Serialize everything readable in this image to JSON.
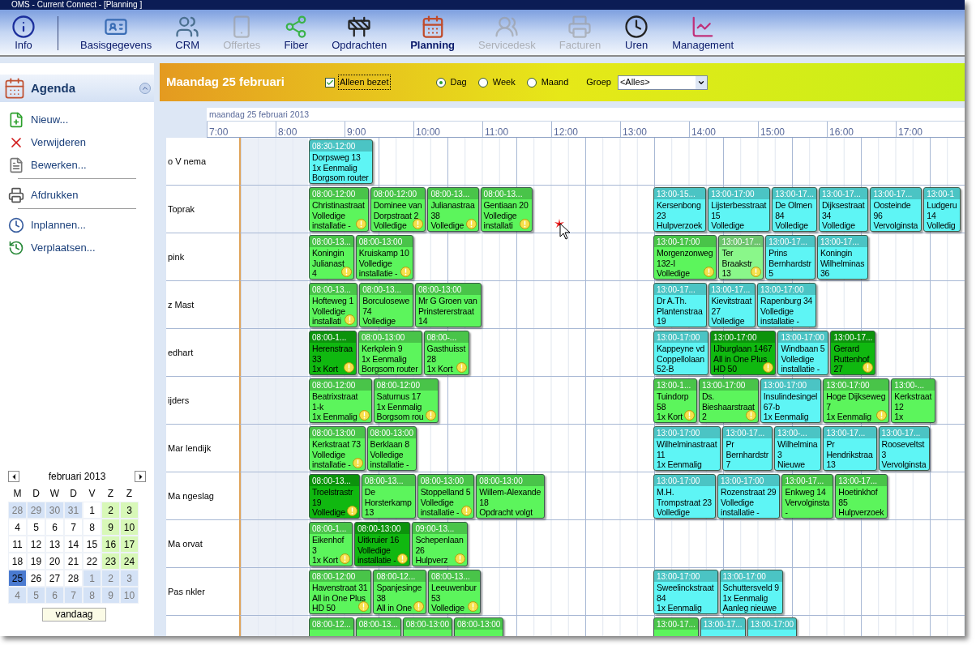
{
  "window": {
    "title": "OMS - Current Connect - [Planning  ]"
  },
  "toolbar": {
    "items": [
      {
        "label": "Info",
        "selected": false,
        "disabled": false
      },
      {
        "label": "Basisgegevens",
        "selected": false,
        "disabled": false
      },
      {
        "label": "CRM",
        "selected": false,
        "disabled": false
      },
      {
        "label": "Offertes",
        "selected": false,
        "disabled": true
      },
      {
        "label": "Fiber",
        "selected": false,
        "disabled": false
      },
      {
        "label": "Opdrachten",
        "selected": false,
        "disabled": false
      },
      {
        "label": "Planning",
        "selected": true,
        "disabled": false
      },
      {
        "label": "Servicedesk",
        "selected": false,
        "disabled": true
      },
      {
        "label": "Facturen",
        "selected": false,
        "disabled": true
      },
      {
        "label": "Uren",
        "selected": false,
        "disabled": false
      },
      {
        "label": "Management",
        "selected": false,
        "disabled": false
      }
    ]
  },
  "sidebar": {
    "title": "Agenda",
    "groups": [
      [
        {
          "label": "Nieuw..."
        },
        {
          "label": "Verwijderen"
        },
        {
          "label": "Bewerken..."
        }
      ],
      [
        {
          "label": "Afdrukken"
        }
      ],
      [
        {
          "label": "Inplannen..."
        },
        {
          "label": "Verplaatsen..."
        }
      ]
    ]
  },
  "mini_calendar": {
    "month": "februari 2013",
    "weekdays": [
      "M",
      "D",
      "W",
      "D",
      "V",
      "Z",
      "Z"
    ],
    "today_button": "vandaag",
    "weeks": [
      [
        {
          "day": "28",
          "kind": "other",
          "selected": false
        },
        {
          "day": "29",
          "kind": "other",
          "selected": false
        },
        {
          "day": "30",
          "kind": "other",
          "selected": false
        },
        {
          "day": "31",
          "kind": "other",
          "selected": false
        },
        {
          "day": "1",
          "kind": "day",
          "selected": false
        },
        {
          "day": "2",
          "kind": "weekend",
          "selected": false
        },
        {
          "day": "3",
          "kind": "weekend",
          "selected": false
        }
      ],
      [
        {
          "day": "4",
          "kind": "day",
          "selected": false
        },
        {
          "day": "5",
          "kind": "day",
          "selected": false
        },
        {
          "day": "6",
          "kind": "day",
          "selected": false
        },
        {
          "day": "7",
          "kind": "day",
          "selected": false
        },
        {
          "day": "8",
          "kind": "day",
          "selected": false
        },
        {
          "day": "9",
          "kind": "weekend",
          "selected": false
        },
        {
          "day": "10",
          "kind": "weekend",
          "selected": false
        }
      ],
      [
        {
          "day": "11",
          "kind": "day",
          "selected": false
        },
        {
          "day": "12",
          "kind": "day",
          "selected": false
        },
        {
          "day": "13",
          "kind": "day",
          "selected": false
        },
        {
          "day": "14",
          "kind": "day",
          "selected": false
        },
        {
          "day": "15",
          "kind": "day",
          "selected": false
        },
        {
          "day": "16",
          "kind": "weekend",
          "selected": false
        },
        {
          "day": "17",
          "kind": "weekend",
          "selected": false
        }
      ],
      [
        {
          "day": "18",
          "kind": "day",
          "selected": false
        },
        {
          "day": "19",
          "kind": "day",
          "selected": false
        },
        {
          "day": "20",
          "kind": "day",
          "selected": false
        },
        {
          "day": "21",
          "kind": "day",
          "selected": false
        },
        {
          "day": "22",
          "kind": "day",
          "selected": false
        },
        {
          "day": "23",
          "kind": "weekend",
          "selected": false
        },
        {
          "day": "24",
          "kind": "weekend",
          "selected": false
        }
      ],
      [
        {
          "day": "25",
          "kind": "day",
          "selected": true
        },
        {
          "day": "26",
          "kind": "day",
          "selected": false
        },
        {
          "day": "27",
          "kind": "day",
          "selected": false
        },
        {
          "day": "28",
          "kind": "day",
          "selected": false
        },
        {
          "day": "1",
          "kind": "other",
          "selected": false
        },
        {
          "day": "2",
          "kind": "other",
          "selected": false
        },
        {
          "day": "3",
          "kind": "other",
          "selected": false
        }
      ],
      [
        {
          "day": "4",
          "kind": "other",
          "selected": false
        },
        {
          "day": "5",
          "kind": "other",
          "selected": false
        },
        {
          "day": "6",
          "kind": "other",
          "selected": false
        },
        {
          "day": "7",
          "kind": "other",
          "selected": false
        },
        {
          "day": "8",
          "kind": "other",
          "selected": false
        },
        {
          "day": "9",
          "kind": "other",
          "selected": false
        },
        {
          "day": "10",
          "kind": "other",
          "selected": false
        }
      ]
    ]
  },
  "header": {
    "title": "Maandag 25 februari",
    "only_busy": {
      "label": "Alleen bezet",
      "checked": true
    },
    "views": [
      {
        "label": "Dag",
        "selected": true
      },
      {
        "label": "Week",
        "selected": false
      },
      {
        "label": "Maand",
        "selected": false
      }
    ],
    "group": {
      "label": "Groep",
      "value": "<Alles>"
    }
  },
  "schedule": {
    "date": "maandag 25 februari 2013",
    "hours": [
      "7:00",
      "8:00",
      "9:00",
      "10:00",
      "11:00",
      "12:00",
      "13:00",
      "14:00",
      "15:00",
      "16:00",
      "17:00"
    ],
    "rows": [
      {
        "name": "o V nema",
        "morning": [
          {
            "time": "08:30-12:00",
            "lines": [
              "Dorpsweg  13",
              "1x Eenmalig",
              "Borgsom router"
            ],
            "color": "#5ef5f5",
            "warning": false
          }
        ],
        "afternoon": []
      },
      {
        "name": "Toprak",
        "morning": [
          {
            "time": "08:00-12:00",
            "lines": [
              "Christinastraat",
              "Volledige",
              "installatie -"
            ],
            "color": "#5cf55c",
            "warning": true
          },
          {
            "time": "08:00-12:00",
            "lines": [
              "Dominee van",
              "Dorpstraat 2",
              "Volledige"
            ],
            "color": "#5cf55c",
            "warning": true
          },
          {
            "time": "08:00-13...",
            "lines": [
              "Julianastraa",
              "38",
              "Volledige"
            ],
            "color": "#5cf55c",
            "warning": true
          },
          {
            "time": "08:00-13...",
            "lines": [
              "Gentiaan 20",
              "Volledige",
              "installati"
            ],
            "color": "#5cf55c",
            "warning": true
          }
        ],
        "afternoon": [
          {
            "time": "13:00-15...",
            "lines": [
              "Kersenbong",
              "23",
              "Hulpverzoek"
            ],
            "color": "#5ef5f5",
            "warning": false
          },
          {
            "time": "13:00-17:00",
            "lines": [
              "Lijsterbesstraat",
              "15",
              "Volledige"
            ],
            "color": "#5ef5f5",
            "warning": false
          },
          {
            "time": "13:00-17...",
            "lines": [
              "De Olmen",
              "84",
              "Volledige"
            ],
            "color": "#5ef5f5",
            "warning": false
          },
          {
            "time": "13:00-17...",
            "lines": [
              "Dijksestraat",
              "34",
              "Volledige"
            ],
            "color": "#5ef5f5",
            "warning": false
          },
          {
            "time": "13:00-17...",
            "lines": [
              "Oosteinde",
              "96",
              "Vervolginsta"
            ],
            "color": "#5ef5f5",
            "warning": false
          },
          {
            "time": "13:00-1",
            "lines": [
              "Ludgeru",
              "14",
              "Volledig"
            ],
            "color": "#5ef5f5",
            "warning": false
          }
        ]
      },
      {
        "name": "pink",
        "morning": [
          {
            "time": "08:00-13...",
            "lines": [
              "Koningin",
              "Julianast",
              "4"
            ],
            "color": "#5cf55c",
            "warning": true
          },
          {
            "time": "08:00-13:00",
            "lines": [
              "Kruiskamp 10",
              "Volledige",
              "installatie -"
            ],
            "color": "#5cf55c",
            "warning": true
          }
        ],
        "afternoon": [
          {
            "time": "13:00-17:00",
            "lines": [
              "Morgenzonweg",
              "132-I",
              "Volledige"
            ],
            "color": "#5cf55c",
            "warning": true
          },
          {
            "time": "13:00-17...",
            "lines": [
              "Ter",
              "Braakstr",
              "13"
            ],
            "color": "#8af78a",
            "warning": true
          },
          {
            "time": "13:00-17...",
            "lines": [
              "Prins",
              "Bernhardstr",
              "5"
            ],
            "color": "#5ef5f5",
            "warning": false
          },
          {
            "time": "13:00-17...",
            "lines": [
              "Koningin",
              "Wilhelminas",
              "36"
            ],
            "color": "#5ef5f5",
            "warning": false
          }
        ]
      },
      {
        "name": "z Mast",
        "morning": [
          {
            "time": "08:00-13...",
            "lines": [
              "Hofteweg 1",
              "Volledige",
              "installati"
            ],
            "color": "#5cf55c",
            "warning": true
          },
          {
            "time": "08:00-13...",
            "lines": [
              "Borculosewe",
              "74",
              "Volledige"
            ],
            "color": "#5cf55c",
            "warning": false
          },
          {
            "time": "08:00-13:00",
            "lines": [
              "Mr G Groen van",
              "Prinstererstraat",
              "14"
            ],
            "color": "#5cf55c",
            "warning": false
          }
        ],
        "afternoon": [
          {
            "time": "13:00-17...",
            "lines": [
              "Dr A.Th.",
              "Plantenstraa",
              "19"
            ],
            "color": "#5ef5f5",
            "warning": false
          },
          {
            "time": "13:00-17...",
            "lines": [
              "Kievitstraat",
              "27",
              "Volledige"
            ],
            "color": "#5ef5f5",
            "warning": false
          },
          {
            "time": "13:00-17:00",
            "lines": [
              "Rapenburg 34",
              "Volledige",
              "installatie -"
            ],
            "color": "#5ef5f5",
            "warning": false
          }
        ]
      },
      {
        "name": "edhart",
        "morning": [
          {
            "time": "08:00-1...",
            "lines": [
              "Herenstraa",
              "33",
              "1x Kort"
            ],
            "color": "#10b810",
            "warning": true
          },
          {
            "time": "08:00-13:00",
            "lines": [
              "Kerkplein  9",
              "1x Eenmalig",
              "Borgsom router"
            ],
            "color": "#5cf55c",
            "warning": false
          },
          {
            "time": "08:00-...",
            "lines": [
              "Gasthuisst",
              "28",
              "1x Kort"
            ],
            "color": "#5cf55c",
            "warning": true
          }
        ],
        "afternoon": [
          {
            "time": "13:00-17:00",
            "lines": [
              "Kappeyne vd",
              "Coppellolaan",
              "52-B"
            ],
            "color": "#5ef5f5",
            "warning": false
          },
          {
            "time": "13:00-17:00",
            "lines": [
              "IJburglaan 1467",
              "All in One Plus",
              "HD 50"
            ],
            "color": "#10b810",
            "warning": true
          },
          {
            "time": "13:00-17:00",
            "lines": [
              "Windbaan 5",
              "Volledige",
              "installatie -"
            ],
            "color": "#5ef5f5",
            "warning": false
          },
          {
            "time": "13:00-17...",
            "lines": [
              "Gerard",
              "Ruttenhof",
              "27"
            ],
            "color": "#10b810",
            "warning": true
          }
        ]
      },
      {
        "name": "ijders",
        "morning": [
          {
            "time": "08:00-12:00",
            "lines": [
              "Beatrixstraat",
              "1-k",
              "1x Eenmalig"
            ],
            "color": "#5cf55c",
            "warning": true
          },
          {
            "time": "08:00-12:00",
            "lines": [
              "Saturnus  17",
              "1x Eenmalig",
              "Borgsom rou"
            ],
            "color": "#5cf55c",
            "warning": true
          }
        ],
        "afternoon": [
          {
            "time": "13:00-1...",
            "lines": [
              "Tuindorp",
              "58",
              "1x Kort"
            ],
            "color": "#5cf55c",
            "warning": true
          },
          {
            "time": "13:00-17:00",
            "lines": [
              "Ds.",
              "Bieshaarstraat",
              "2"
            ],
            "color": "#5cf55c",
            "warning": true
          },
          {
            "time": "13:00-17:00",
            "lines": [
              "Insulindesingel",
              "67-b",
              "1x Eenmalig"
            ],
            "color": "#5ef5f5",
            "warning": false
          },
          {
            "time": "13:00-17:00",
            "lines": [
              "Hoge Dijkseweg",
              "7",
              "1x Eenmalig"
            ],
            "color": "#5cf55c",
            "warning": true
          },
          {
            "time": "13:00-...",
            "lines": [
              "Kerkstraat",
              "12",
              "1x"
            ],
            "color": "#5cf55c",
            "warning": false
          }
        ]
      },
      {
        "name": "Mar lendijk",
        "morning": [
          {
            "time": "08:00-13:00",
            "lines": [
              "Kerkstraat 73",
              "Volledige",
              "installatie -"
            ],
            "color": "#5cf55c",
            "warning": true
          },
          {
            "time": "08:00-13:00",
            "lines": [
              "Berklaan 8",
              "Volledige",
              "installatie -"
            ],
            "color": "#5cf55c",
            "warning": false
          }
        ],
        "afternoon": [
          {
            "time": "13:00-17:00",
            "lines": [
              "Wilhelminastraat",
              "11",
              "1x Eenmalig"
            ],
            "color": "#5ef5f5",
            "warning": false
          },
          {
            "time": "13:00-17...",
            "lines": [
              "Pr",
              "Bernhardstr",
              "7"
            ],
            "color": "#5ef5f5",
            "warning": false
          },
          {
            "time": "13:00-...",
            "lines": [
              "Wilhelmina",
              "3",
              "Nieuwe"
            ],
            "color": "#5ef5f5",
            "warning": false
          },
          {
            "time": "13:00-17...",
            "lines": [
              "Pr",
              "Hendrikstraa",
              "13"
            ],
            "color": "#5ef5f5",
            "warning": false
          },
          {
            "time": "13:00-17...",
            "lines": [
              "Rooseveltst",
              "3",
              "Vervolginsta"
            ],
            "color": "#5ef5f5",
            "warning": false
          }
        ]
      },
      {
        "name": "Ma ngeslag",
        "morning": [
          {
            "time": "08:00-13...",
            "lines": [
              "Troelstrastr",
              "19",
              "Volledige"
            ],
            "color": "#10b810",
            "warning": true
          },
          {
            "time": "08:00-13...",
            "lines": [
              "De",
              "Horsterkamp",
              "13"
            ],
            "color": "#5cf55c",
            "warning": false
          },
          {
            "time": "08:00-13:00",
            "lines": [
              "Stoppelland 5",
              "Volledige",
              "installatie -"
            ],
            "color": "#5cf55c",
            "warning": true
          },
          {
            "time": "08:00-13:00",
            "lines": [
              "Willem-Alexande",
              "18",
              "Opdracht volgt"
            ],
            "color": "#5cf55c",
            "warning": false
          }
        ],
        "afternoon": [
          {
            "time": "13:00-17:00",
            "lines": [
              "M.H.",
              "Trompstraat 23",
              "Volledige"
            ],
            "color": "#5ef5f5",
            "warning": false
          },
          {
            "time": "13:00-17:00",
            "lines": [
              "Rozenstraat 29",
              "Volledige",
              "installatie -"
            ],
            "color": "#5ef5f5",
            "warning": false
          },
          {
            "time": "13:00-17...",
            "lines": [
              "Enkweg 14",
              "Vervolginsta",
              "-"
            ],
            "color": "#5cf55c",
            "warning": false
          },
          {
            "time": "13:00-17...",
            "lines": [
              "Hoetinkhof",
              "85",
              "Hulpverzoek"
            ],
            "color": "#5cf55c",
            "warning": false
          }
        ]
      },
      {
        "name": "Ma orvat",
        "morning": [
          {
            "time": "08:00-1...",
            "lines": [
              "Eikenhof",
              "3",
              "1x Kort"
            ],
            "color": "#5cf55c",
            "warning": true
          },
          {
            "time": "08:00-13:00",
            "lines": [
              "Uitkruier 16",
              "Volledige",
              "installatie -"
            ],
            "color": "#10b810",
            "warning": true
          },
          {
            "time": "09:00-13...",
            "lines": [
              "Schepenlaan",
              "26",
              "Hulpverz"
            ],
            "color": "#5cf55c",
            "warning": true
          }
        ],
        "afternoon": []
      },
      {
        "name": "Pas nkler",
        "morning": [
          {
            "time": "08:00-12:00",
            "lines": [
              "Havenstraat 31",
              "All in One Plus",
              "HD 50"
            ],
            "color": "#5cf55c",
            "warning": true
          },
          {
            "time": "08:00-12...",
            "lines": [
              "Spanjesinge",
              "38",
              "All in One"
            ],
            "color": "#5cf55c",
            "warning": true
          },
          {
            "time": "08:00-13...",
            "lines": [
              "Leeuwenbur",
              "53",
              "Volledige"
            ],
            "color": "#5cf55c",
            "warning": true
          }
        ],
        "afternoon": [
          {
            "time": "13:00-17:00",
            "lines": [
              "Sweelinckstraat",
              "84",
              "1x Eenmalig"
            ],
            "color": "#5ef5f5",
            "warning": false
          },
          {
            "time": "13:00-17:00",
            "lines": [
              "Schuttersveld  9",
              "1x Eenmalig",
              "Aanleg nieuwe"
            ],
            "color": "#5ef5f5",
            "warning": false
          }
        ]
      },
      {
        "morning": [
          {
            "time": "08:00-12...",
            "color": "#5cf55c",
            "warning": false
          },
          {
            "time": "08:00-13...",
            "color": "#5cf55c",
            "warning": false
          },
          {
            "time": "08:00-13:00",
            "color": "#5cf55c",
            "warning": false
          },
          {
            "time": "08:00-13:00",
            "color": "#5cf55c",
            "warning": false
          }
        ],
        "afternoon": [
          {
            "time": "13:00-17...",
            "color": "#5cf55c",
            "warning": false
          },
          {
            "time": "13:00-17...",
            "color": "#5ef5f5",
            "warning": false
          },
          {
            "time": "13:00-17:00",
            "color": "#5ef5f5",
            "warning": false
          }
        ]
      }
    ]
  }
}
